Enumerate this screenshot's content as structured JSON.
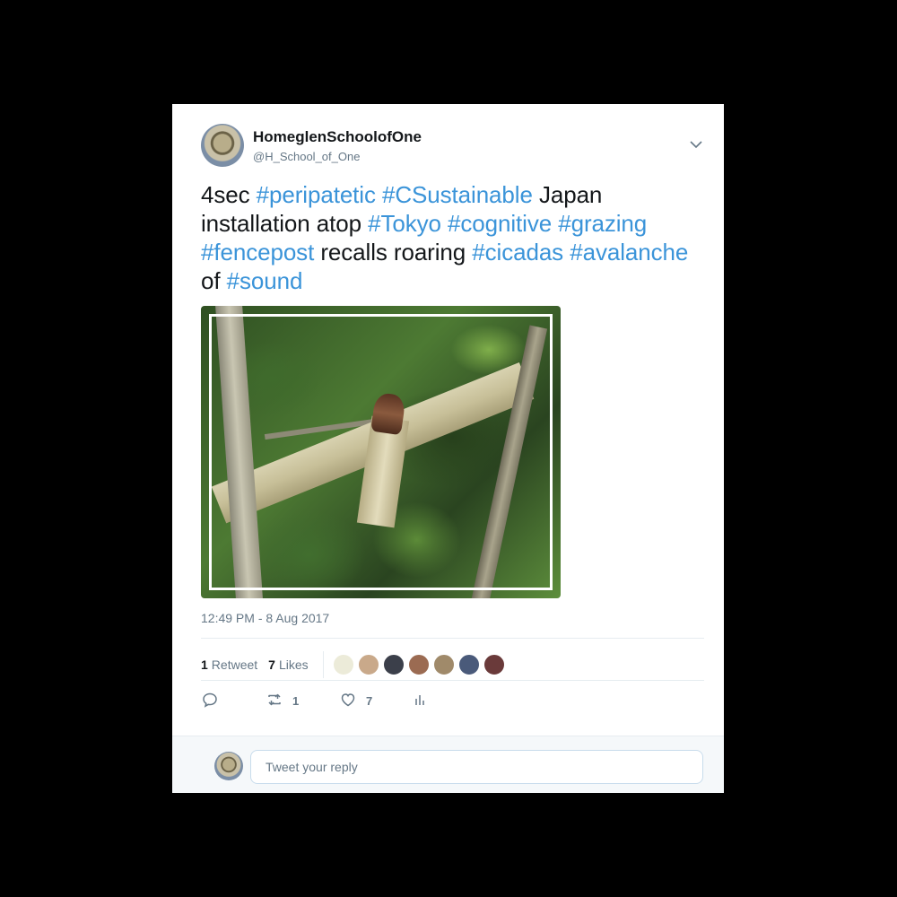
{
  "user": {
    "display_name": "HomeglenSchoolofOne",
    "handle": "@H_School_of_One"
  },
  "tweet": {
    "segments": [
      {
        "text": "4sec ",
        "hashtag": false
      },
      {
        "text": "#peripatetic",
        "hashtag": true
      },
      {
        "text": " ",
        "hashtag": false
      },
      {
        "text": "#CSustainable",
        "hashtag": true
      },
      {
        "text": " Japan installation atop ",
        "hashtag": false
      },
      {
        "text": "#Tokyo",
        "hashtag": true
      },
      {
        "text": " ",
        "hashtag": false
      },
      {
        "text": "#cognitive",
        "hashtag": true
      },
      {
        "text": " ",
        "hashtag": false
      },
      {
        "text": "#grazing",
        "hashtag": true
      },
      {
        "text": " ",
        "hashtag": false
      },
      {
        "text": "#fencepost",
        "hashtag": true
      },
      {
        "text": " recalls roaring ",
        "hashtag": false
      },
      {
        "text": "#cicadas",
        "hashtag": true
      },
      {
        "text": " ",
        "hashtag": false
      },
      {
        "text": "#avalanche",
        "hashtag": true
      },
      {
        "text": " of ",
        "hashtag": false
      },
      {
        "text": "#sound",
        "hashtag": true
      }
    ],
    "timestamp": "12:49 PM - 8 Aug 2017"
  },
  "stats": {
    "retweets_count": "1",
    "retweets_label": "Retweet",
    "likes_count": "7",
    "likes_label": "Likes",
    "liker_colors": [
      "#ecebd9",
      "#c9a98a",
      "#3b3f4a",
      "#9b6b52",
      "#a08a6a",
      "#4a5a7a",
      "#6a3a3a"
    ]
  },
  "actions": {
    "reply_count": "",
    "retweet_count": "1",
    "like_count": "7"
  },
  "reply": {
    "placeholder": "Tweet your reply"
  },
  "colors": {
    "hashtag": "#3b94d9",
    "text": "#14171a",
    "muted": "#657786"
  }
}
